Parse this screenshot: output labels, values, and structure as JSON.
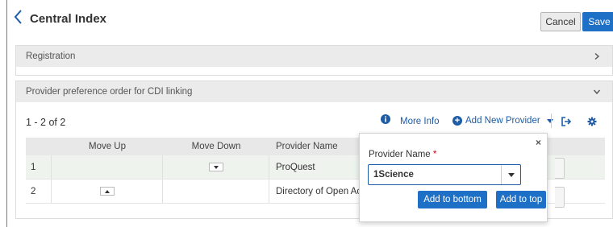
{
  "header": {
    "title": "Central Index",
    "cancel_label": "Cancel",
    "save_label": "Save"
  },
  "sections": {
    "registration": {
      "label": "Registration"
    },
    "provider_order": {
      "label": "Provider preference order for CDI linking"
    }
  },
  "toolbar": {
    "count": "1 - 2 of 2",
    "more_info": "More Info",
    "add_provider": "Add New Provider"
  },
  "table": {
    "columns": [
      "Move Up",
      "Move Down",
      "Provider Name"
    ],
    "rows": [
      {
        "num": "1",
        "name": "ProQuest"
      },
      {
        "num": "2",
        "name": "Directory of Open Access Journals"
      }
    ]
  },
  "popup": {
    "label": "Provider Name",
    "required_mark": "*",
    "selected_value": "1Science",
    "add_bottom_label": "Add to bottom",
    "add_top_label": "Add to top",
    "close_glyph": "×"
  },
  "colors": {
    "accent": "#1e70c6",
    "link": "#1e5ca6",
    "section_header_bg": "#ebebeb",
    "selected_row_bg": "#eef3ee"
  },
  "icons": [
    "chevron-left-icon",
    "chevron-right-icon",
    "chevron-down-icon",
    "info-icon",
    "plus-circle-icon",
    "export-icon",
    "gear-icon",
    "close-icon"
  ]
}
